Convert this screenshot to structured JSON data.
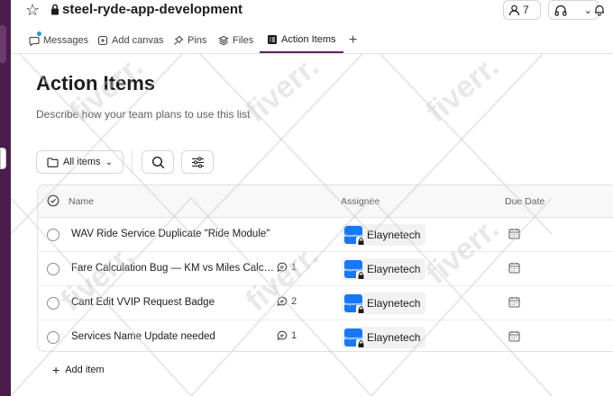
{
  "channel": {
    "name": "steel-ryde-app-development",
    "member_count": "7"
  },
  "tabs": [
    {
      "label": "Messages"
    },
    {
      "label": "Add canvas"
    },
    {
      "label": "Pins"
    },
    {
      "label": "Files"
    },
    {
      "label": "Action Items"
    }
  ],
  "page": {
    "title": "Action Items",
    "description": "Describe how your team plans to use this list"
  },
  "toolbar": {
    "filter_label": "All items"
  },
  "table": {
    "columns": [
      "Name",
      "Assignee",
      "Due Date"
    ],
    "rows": [
      {
        "name": "WAV Ride Service Duplicate \"Ride Module\"",
        "comments": "",
        "assignee": "Elaynetech"
      },
      {
        "name": "Fare Calculation Bug — KM vs Miles Calculation",
        "comments": "1",
        "assignee": "Elaynetech"
      },
      {
        "name": "Cant Edit VVIP Request Badge",
        "comments": "2",
        "assignee": "Elaynetech"
      },
      {
        "name": "Services Name Update needed",
        "comments": "1",
        "assignee": "Elaynetech"
      }
    ],
    "add_item_label": "Add item"
  },
  "avatar_text": "Elaynetech",
  "watermark": "fiverr.",
  "colors": {
    "accent": "#611f69",
    "sidebar": "#4a1d4c",
    "avatar": "#1877f2",
    "notification_dot": "#1d9bd1"
  }
}
